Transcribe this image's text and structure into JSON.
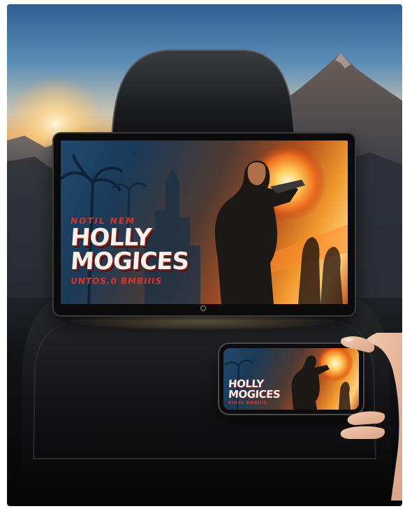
{
  "tablet": {
    "poster": {
      "kicker": "NOTIL NEM",
      "title_line1": "HOLLY",
      "title_line2": "MOGICES",
      "subtitle": "UNTOS.0 BMBIIIS"
    }
  },
  "phone": {
    "poster": {
      "title_line1": "HOLLY",
      "title_line2": "MOGICES",
      "subtitle": "KIOSS BMBIIIS"
    }
  },
  "icons": {
    "home": "power-button-icon"
  },
  "colors": {
    "title_red": "#e0322a",
    "explosion": "#f39a2f",
    "sky": "#5c8fb8"
  }
}
